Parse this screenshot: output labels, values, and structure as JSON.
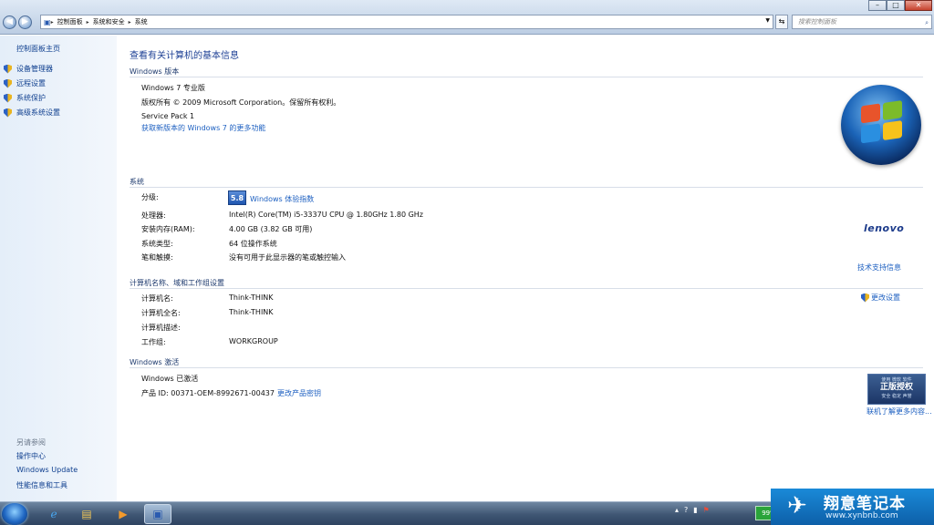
{
  "window": {
    "buttons": {
      "minimize": "–",
      "maximize": "□",
      "close": "✕"
    }
  },
  "address_bar": {
    "crumbs": [
      "控制面板",
      "系统和安全",
      "系统"
    ],
    "search_placeholder": "搜索控制面板"
  },
  "sidebar": {
    "home": "控制面板主页",
    "items": [
      {
        "label": "设备管理器",
        "icon": "shield-icon"
      },
      {
        "label": "远程设置",
        "icon": "shield-icon"
      },
      {
        "label": "系统保护",
        "icon": "shield-icon"
      },
      {
        "label": "高级系统设置",
        "icon": "shield-icon"
      }
    ],
    "see_also_title": "另请参阅",
    "see_also": [
      "操作中心",
      "Windows Update",
      "性能信息和工具"
    ]
  },
  "main": {
    "page_title": "查看有关计算机的基本信息",
    "edition": {
      "section": "Windows 版本",
      "name": "Windows 7 专业版",
      "copyright": "版权所有 © 2009 Microsoft Corporation。保留所有权利。",
      "service_pack": "Service Pack 1",
      "more_features_link": "获取新版本的 Windows 7 的更多功能"
    },
    "system": {
      "section": "系统",
      "rating_label": "分级:",
      "rating_score": "5.8",
      "rating_link": "Windows 体验指数",
      "processor_label": "处理器:",
      "processor": "Intel(R) Core(TM) i5-3337U CPU @ 1.80GHz   1.80 GHz",
      "ram_label": "安装内存(RAM):",
      "ram": "4.00 GB (3.82 GB 可用)",
      "type_label": "系统类型:",
      "type": "64 位操作系统",
      "pen_label": "笔和触摸:",
      "pen": "没有可用于此显示器的笔或触控输入",
      "oem_brand": "lenovo",
      "support_link": "技术支持信息"
    },
    "computer": {
      "section": "计算机名称、域和工作组设置",
      "name_label": "计算机名:",
      "name": "Think-THINK",
      "full_name_label": "计算机全名:",
      "full_name": "Think-THINK",
      "desc_label": "计算机描述:",
      "desc": "",
      "workgroup_label": "工作组:",
      "workgroup": "WORKGROUP",
      "change_link": "更改设置"
    },
    "activation": {
      "section": "Windows 激活",
      "status": "Windows 已激活",
      "product_id": "产品 ID: 00371-OEM-8992671-00437",
      "change_key_link": "更改产品密钥",
      "genuine_top": "使用 微软 软件",
      "genuine_main": "正版授权",
      "genuine_bottom": "安全 稳定 声誉",
      "learn_more_link": "联机了解更多内容..."
    }
  },
  "taskbar": {
    "battery": "99%",
    "watermark_title": "翔意笔记本",
    "watermark_url": "www.xynbnb.com"
  },
  "colors": {
    "link": "#1c5fc0",
    "heading": "#1c3f94",
    "sidebar_bg": "#e4eef9"
  }
}
